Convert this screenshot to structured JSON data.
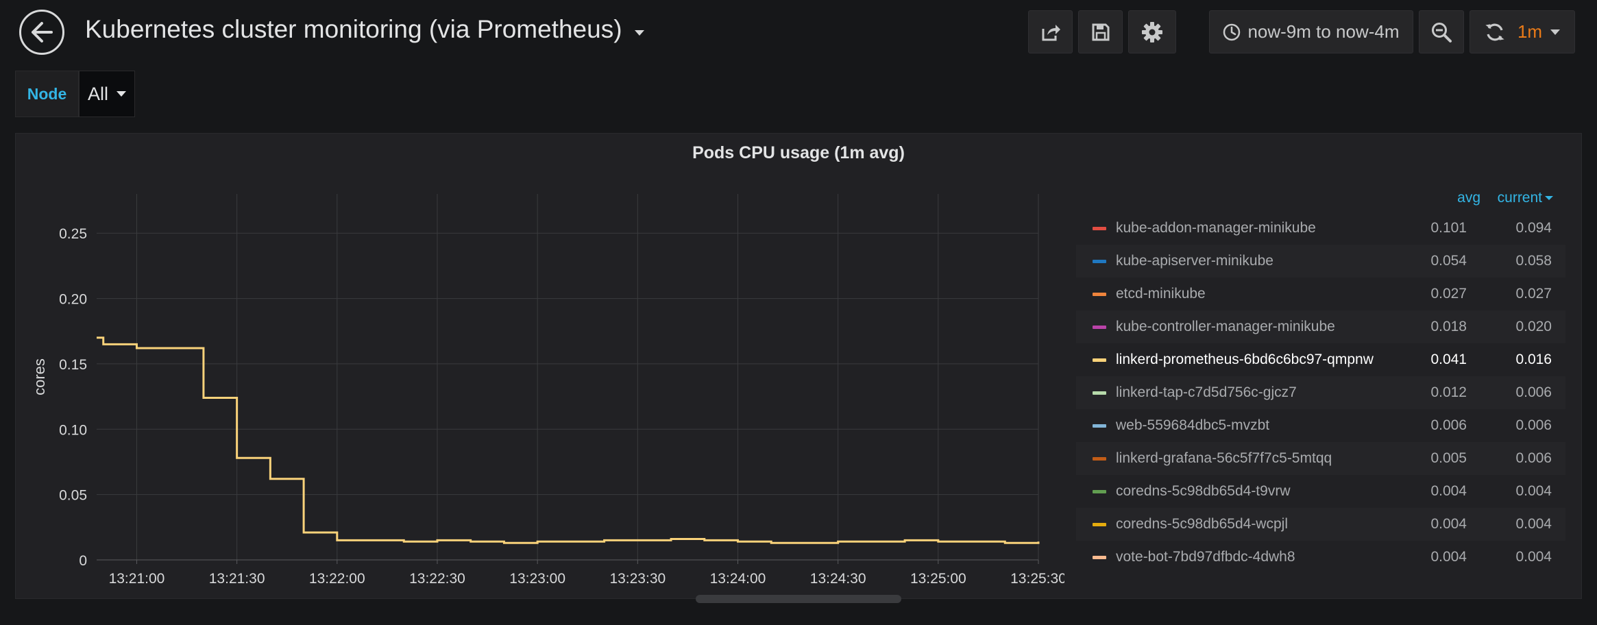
{
  "header": {
    "title": "Kubernetes cluster monitoring (via Prometheus)",
    "time_range": "now-9m to now-4m",
    "refresh_interval": "1m",
    "icons": [
      "back-arrow-icon",
      "share-icon",
      "save-icon",
      "gear-icon",
      "clock-icon",
      "zoom-out-icon",
      "refresh-icon"
    ]
  },
  "variables": {
    "node_label": "Node",
    "node_value": "All"
  },
  "panel": {
    "title": "Pods CPU usage (1m avg)",
    "legend_headers": {
      "avg": "avg",
      "current": "current"
    },
    "legend": [
      {
        "name": "kube-addon-manager-minikube",
        "color": "#e24d42",
        "avg": "0.101",
        "current": "0.094"
      },
      {
        "name": "kube-apiserver-minikube",
        "color": "#1f78c1",
        "avg": "0.054",
        "current": "0.058"
      },
      {
        "name": "etcd-minikube",
        "color": "#ef843c",
        "avg": "0.027",
        "current": "0.027"
      },
      {
        "name": "kube-controller-manager-minikube",
        "color": "#ba43a9",
        "avg": "0.018",
        "current": "0.020"
      },
      {
        "name": "linkerd-prometheus-6bd6c6bc97-qmpnw",
        "color": "#f9d27a",
        "avg": "0.041",
        "current": "0.016",
        "active": true
      },
      {
        "name": "linkerd-tap-c7d5d756c-gjcz7",
        "color": "#b7dbab",
        "avg": "0.012",
        "current": "0.006"
      },
      {
        "name": "web-559684dbc5-mvzbt",
        "color": "#82b5d8",
        "avg": "0.006",
        "current": "0.006"
      },
      {
        "name": "linkerd-grafana-56c5f7f7c5-5mtqq",
        "color": "#c15c17",
        "avg": "0.005",
        "current": "0.006"
      },
      {
        "name": "coredns-5c98db65d4-t9vrw",
        "color": "#629e51",
        "avg": "0.004",
        "current": "0.004"
      },
      {
        "name": "coredns-5c98db65d4-wcpjl",
        "color": "#e5ac0e",
        "avg": "0.004",
        "current": "0.004"
      },
      {
        "name": "vote-bot-7bd97dfbdc-4dwh8",
        "color": "#f9ba8f",
        "avg": "0.004",
        "current": "0.004"
      }
    ]
  },
  "chart_data": {
    "type": "line",
    "title": "Pods CPU usage (1m avg)",
    "ylabel": "cores",
    "xlabel": "",
    "ylim": [
      0,
      0.28
    ],
    "xlim_seconds": [
      "13:20:48",
      "13:25:30"
    ],
    "yticks": [
      "0",
      "0.05",
      "0.10",
      "0.15",
      "0.20",
      "0.25"
    ],
    "ytick_values": [
      0,
      0.05,
      0.1,
      0.15,
      0.2,
      0.25
    ],
    "xticks": [
      "13:21:00",
      "13:21:30",
      "13:22:00",
      "13:22:30",
      "13:23:00",
      "13:23:30",
      "13:24:00",
      "13:24:30",
      "13:25:00",
      "13:25:30"
    ],
    "grid": true,
    "series": [
      {
        "name": "linkerd-prometheus-6bd6c6bc97-qmpnw",
        "color": "#f9d27a",
        "step": true,
        "x": [
          "13:20:48",
          "13:20:50",
          "13:21:00",
          "13:21:10",
          "13:21:20",
          "13:21:30",
          "13:21:40",
          "13:21:50",
          "13:22:00",
          "13:22:10",
          "13:22:20",
          "13:22:30",
          "13:22:40",
          "13:22:50",
          "13:23:00",
          "13:23:10",
          "13:23:20",
          "13:23:30",
          "13:23:40",
          "13:23:50",
          "13:24:00",
          "13:24:10",
          "13:24:20",
          "13:24:30",
          "13:24:40",
          "13:24:50",
          "13:25:00",
          "13:25:10",
          "13:25:20",
          "13:25:30"
        ],
        "y": [
          0.17,
          0.165,
          0.162,
          0.162,
          0.124,
          0.078,
          0.062,
          0.021,
          0.015,
          0.015,
          0.014,
          0.015,
          0.014,
          0.013,
          0.014,
          0.014,
          0.015,
          0.015,
          0.016,
          0.015,
          0.014,
          0.013,
          0.013,
          0.014,
          0.014,
          0.015,
          0.014,
          0.014,
          0.013,
          0.014
        ]
      }
    ]
  }
}
